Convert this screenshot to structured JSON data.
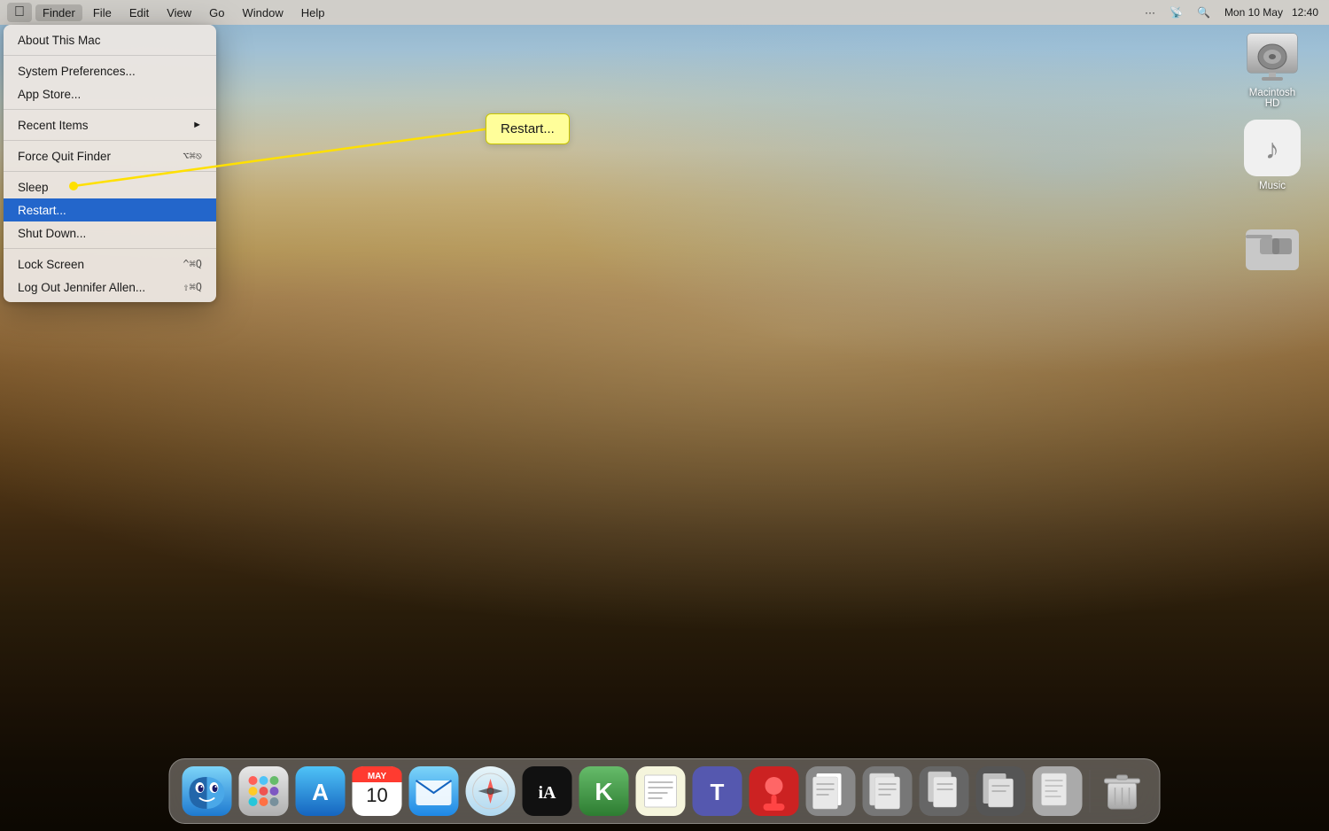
{
  "menubar": {
    "apple_label": "",
    "items": [
      "Finder",
      "File",
      "Edit",
      "View",
      "Go",
      "Window",
      "Help"
    ],
    "active_index": 0,
    "right_items": [
      "···",
      "📡",
      "🔍",
      "Mon 10 May",
      "12:40"
    ]
  },
  "apple_menu": {
    "items": [
      {
        "id": "about",
        "label": "About This Mac",
        "shortcut": "",
        "has_arrow": false,
        "separator_after": false
      },
      {
        "id": "sep1",
        "type": "separator"
      },
      {
        "id": "prefs",
        "label": "System Preferences...",
        "shortcut": "",
        "has_arrow": false,
        "separator_after": false
      },
      {
        "id": "appstore",
        "label": "App Store...",
        "shortcut": "",
        "has_arrow": false,
        "separator_after": false
      },
      {
        "id": "sep2",
        "type": "separator"
      },
      {
        "id": "recent",
        "label": "Recent Items",
        "shortcut": "",
        "has_arrow": true,
        "separator_after": false
      },
      {
        "id": "sep3",
        "type": "separator"
      },
      {
        "id": "forcequit",
        "label": "Force Quit Finder",
        "shortcut": "⌥⌘⎋",
        "has_arrow": false,
        "separator_after": false
      },
      {
        "id": "sep4",
        "type": "separator"
      },
      {
        "id": "sleep",
        "label": "Sleep",
        "shortcut": "",
        "has_arrow": false,
        "separator_after": false
      },
      {
        "id": "restart",
        "label": "Restart...",
        "shortcut": "",
        "has_arrow": false,
        "separator_after": false,
        "highlighted": true
      },
      {
        "id": "shutdown",
        "label": "Shut Down...",
        "shortcut": "",
        "has_arrow": false,
        "separator_after": false
      },
      {
        "id": "sep5",
        "type": "separator"
      },
      {
        "id": "lockscreen",
        "label": "Lock Screen",
        "shortcut": "^⌘Q",
        "has_arrow": false,
        "separator_after": false
      },
      {
        "id": "logout",
        "label": "Log Out Jennifer Allen...",
        "shortcut": "⇧⌘Q",
        "has_arrow": false,
        "separator_after": false
      }
    ]
  },
  "tooltip": {
    "label": "Restart..."
  },
  "desktop_icons": [
    {
      "id": "macintosh-hd",
      "label": "Macintosh HD",
      "type": "hd"
    },
    {
      "id": "music",
      "label": "Music",
      "type": "music"
    },
    {
      "id": "folder3",
      "label": "",
      "type": "folder"
    }
  ],
  "dock": {
    "icons": [
      {
        "id": "finder",
        "label": "Finder",
        "color": "#4aa8e8",
        "emoji": "😊"
      },
      {
        "id": "launchpad",
        "label": "Launchpad",
        "color": "#e8e8e8",
        "emoji": "🚀"
      },
      {
        "id": "appstore",
        "label": "App Store",
        "color": "#2196F3",
        "emoji": "🅐"
      },
      {
        "id": "calendar",
        "label": "Calendar",
        "color": "#ff3b30",
        "emoji": "📅"
      },
      {
        "id": "mail",
        "label": "Mail",
        "color": "#4fc3f7",
        "emoji": "✉️"
      },
      {
        "id": "safari",
        "label": "Safari",
        "color": "#4fc3f7",
        "emoji": "🧭"
      },
      {
        "id": "ia-writer",
        "label": "iA Writer",
        "color": "#111",
        "emoji": "✍"
      },
      {
        "id": "keePass",
        "label": "KeePassXC",
        "color": "#4caf50",
        "emoji": "🔑"
      },
      {
        "id": "textedit",
        "label": "TextEdit",
        "color": "#e8e8d8",
        "emoji": "📝"
      },
      {
        "id": "teams",
        "label": "Teams",
        "color": "#5558af",
        "emoji": "T"
      },
      {
        "id": "joystick",
        "label": "Joystick",
        "color": "#cc2222",
        "emoji": "🕹"
      },
      {
        "id": "docreader1",
        "label": "Documents",
        "color": "#888",
        "emoji": "📄"
      },
      {
        "id": "docreader2",
        "label": "Documents2",
        "color": "#777",
        "emoji": "📄"
      },
      {
        "id": "docreader3",
        "label": "Documents3",
        "color": "#666",
        "emoji": "📄"
      },
      {
        "id": "docreader4",
        "label": "Documents4",
        "color": "#555",
        "emoji": "📄"
      },
      {
        "id": "docreader5",
        "label": "Documents5",
        "color": "#aaa",
        "emoji": "📄"
      },
      {
        "id": "trash",
        "label": "Trash",
        "color": "#888",
        "emoji": "🗑"
      }
    ]
  },
  "colors": {
    "menu_bg": "rgba(235,230,225,0.95)",
    "highlight": "#0050c8",
    "tooltip_bg": "#FFFE9A",
    "tooltip_border": "#c8c400"
  }
}
